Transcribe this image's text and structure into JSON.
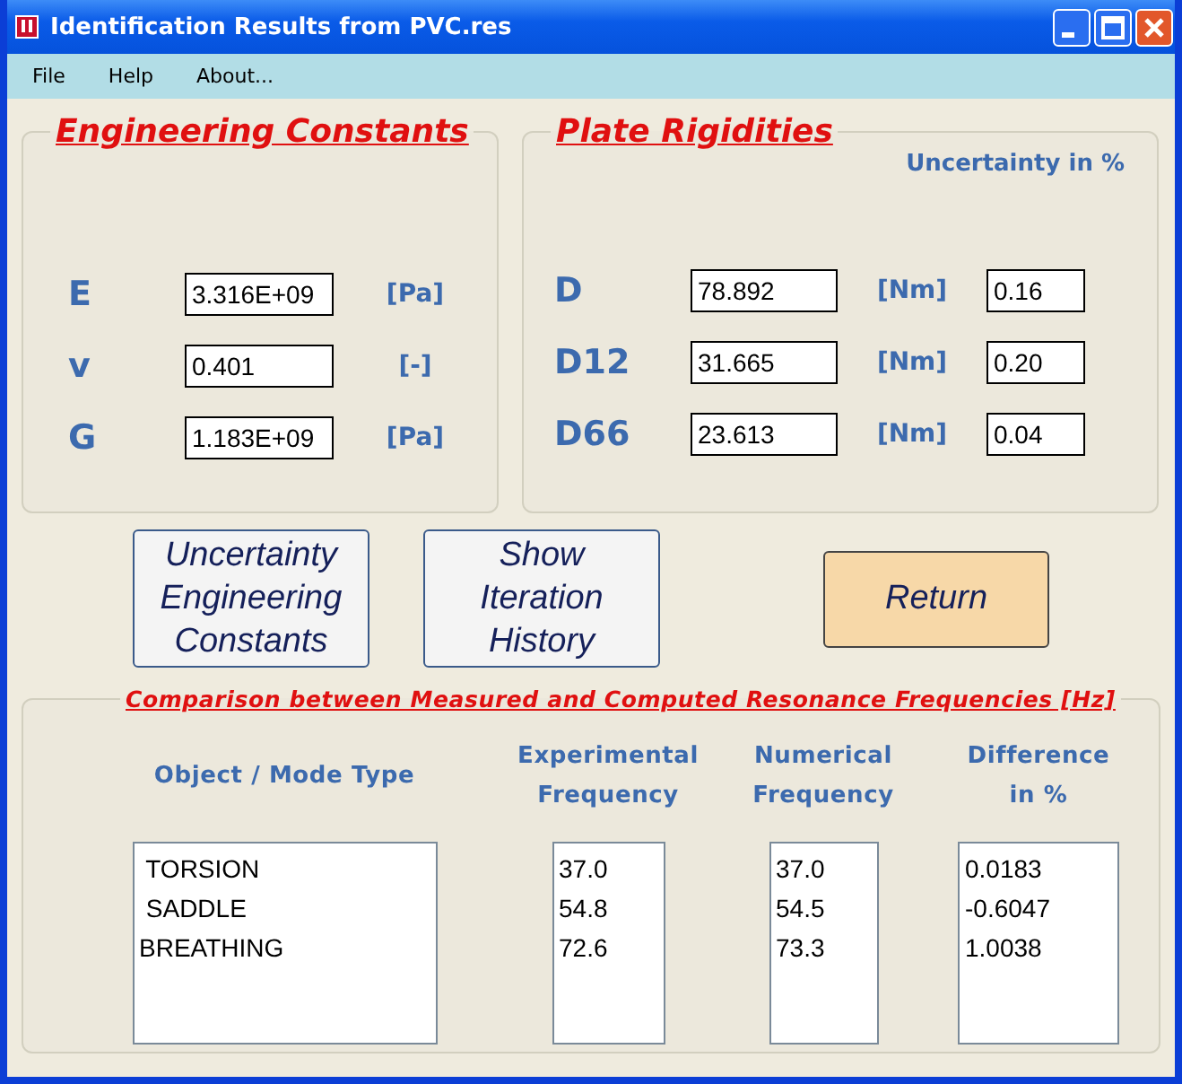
{
  "window": {
    "title": "Identification Results from PVC.res"
  },
  "menu": [
    "File",
    "Help",
    "About..."
  ],
  "engineering_constants": {
    "title": "Engineering Constants",
    "rows": [
      {
        "label": "E",
        "value": "3.316E+09",
        "unit": "[Pa]"
      },
      {
        "label": "v",
        "value": "0.401",
        "unit": "[-]"
      },
      {
        "label": "G",
        "value": "1.183E+09",
        "unit": "[Pa]"
      }
    ]
  },
  "plate_rigidities": {
    "title": "Plate Rigidities",
    "uncertainty_heading": "Uncertainty in %",
    "rows": [
      {
        "label": "D",
        "value": "78.892",
        "unit": "[Nm]",
        "uncertainty": "0.16"
      },
      {
        "label": "D12",
        "value": "31.665",
        "unit": "[Nm]",
        "uncertainty": "0.20"
      },
      {
        "label": "D66",
        "value": "23.613",
        "unit": "[Nm]",
        "uncertainty": "0.04"
      }
    ]
  },
  "buttons": [
    {
      "kind": "plain",
      "lines": [
        "Uncertainty",
        "Engineering",
        "Constants"
      ]
    },
    {
      "kind": "plain",
      "lines": [
        "Show",
        "Iteration",
        "History"
      ]
    },
    {
      "kind": "accent",
      "lines": [
        "Return"
      ]
    }
  ],
  "comparison": {
    "title": "Comparison between Measured and Computed Resonance Frequencies [Hz]",
    "columns": [
      {
        "heading": [
          "Object / Mode Type"
        ],
        "values": [
          " TORSION",
          " SADDLE",
          "BREATHING"
        ]
      },
      {
        "heading": [
          "Experimental",
          "Frequency"
        ],
        "values": [
          "37.0",
          "54.8",
          "72.6"
        ]
      },
      {
        "heading": [
          "Numerical",
          "Frequency"
        ],
        "values": [
          "37.0",
          "54.5",
          "73.3"
        ]
      },
      {
        "heading": [
          "Difference",
          "in %"
        ],
        "values": [
          "0.0183",
          "-0.6047",
          "1.0038"
        ]
      }
    ]
  }
}
